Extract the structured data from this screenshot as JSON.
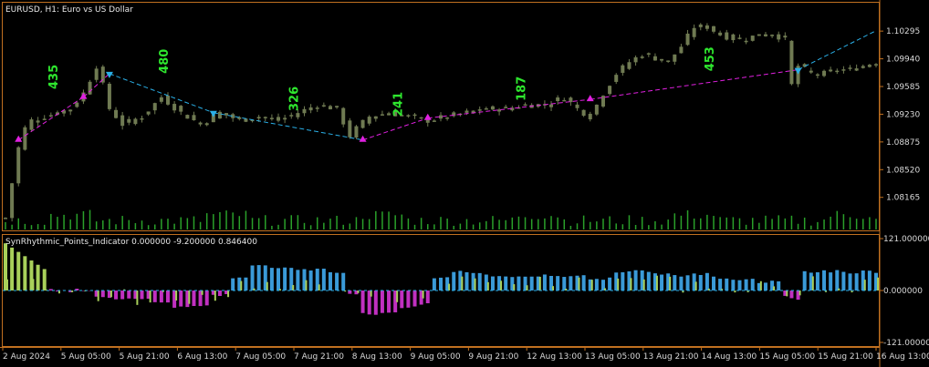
{
  "window": {
    "symbol_title": "EURUSD, H1:  Euro vs US Dollar",
    "indicator_title": "SynRhythmic_Points_Indicator 0.000000 -9.200000 0.846400"
  },
  "colors": {
    "background": "#000000",
    "frame": "#c07020",
    "candle": "#6f7a52",
    "volume": "#2aa02a",
    "up_line": "#2ab0e8",
    "down_line": "#e020e0",
    "count_label": "#2ee62e",
    "hist_blue": "#3a9ad8",
    "hist_magenta": "#c030c0",
    "hist_green": "#a8d05a"
  },
  "price_axis": [
    "1.10295",
    "1.09940",
    "1.09585",
    "1.09230",
    "1.08875",
    "1.08520",
    "1.08165"
  ],
  "indicator_axis": [
    "121.000000",
    "0.000000",
    "-121.000000"
  ],
  "time_axis": [
    "2 Aug 2024",
    "5 Aug 05:00",
    "5 Aug 21:00",
    "6 Aug 13:00",
    "7 Aug 05:00",
    "7 Aug 21:00",
    "8 Aug 13:00",
    "9 Aug 05:00",
    "9 Aug 21:00",
    "12 Aug 13:00",
    "13 Aug 05:00",
    "13 Aug 21:00",
    "14 Aug 13:00",
    "15 Aug 05:00",
    "15 Aug 21:00",
    "16 Aug 13:00"
  ],
  "chart_data": {
    "type": "line",
    "y_range": [
      1.078,
      1.106
    ],
    "price_path": [
      [
        0,
        1.079
      ],
      [
        2,
        1.088
      ],
      [
        3,
        1.0905
      ],
      [
        4,
        1.0915
      ],
      [
        6,
        1.092
      ],
      [
        8,
        1.0925
      ],
      [
        10,
        1.093
      ],
      [
        12,
        1.095
      ],
      [
        14,
        1.0985
      ],
      [
        15,
        1.096
      ],
      [
        16,
        1.093
      ],
      [
        18,
        1.091
      ],
      [
        21,
        1.092
      ],
      [
        24,
        1.0945
      ],
      [
        27,
        1.0925
      ],
      [
        30,
        1.091
      ],
      [
        33,
        1.0925
      ],
      [
        36,
        1.0915
      ],
      [
        39,
        1.092
      ],
      [
        42,
        1.0915
      ],
      [
        45,
        1.0925
      ],
      [
        48,
        1.0935
      ],
      [
        51,
        1.093
      ],
      [
        53,
        1.0895
      ],
      [
        54,
        1.0905
      ],
      [
        56,
        1.092
      ],
      [
        59,
        1.0925
      ],
      [
        62,
        1.092
      ],
      [
        65,
        1.0915
      ],
      [
        68,
        1.092
      ],
      [
        71,
        1.0925
      ],
      [
        74,
        1.093
      ],
      [
        77,
        1.093
      ],
      [
        80,
        1.0935
      ],
      [
        83,
        1.0935
      ],
      [
        86,
        1.0945
      ],
      [
        88,
        1.093
      ],
      [
        90,
        1.092
      ],
      [
        92,
        1.095
      ],
      [
        94,
        1.0975
      ],
      [
        96,
        1.099
      ],
      [
        98,
        1.1
      ],
      [
        100,
        1.0995
      ],
      [
        102,
        1.099
      ],
      [
        104,
        1.101
      ],
      [
        106,
        1.1035
      ],
      [
        108,
        1.1035
      ],
      [
        110,
        1.1025
      ],
      [
        112,
        1.102
      ],
      [
        114,
        1.102
      ],
      [
        116,
        1.1025
      ],
      [
        118,
        1.1025
      ],
      [
        120,
        1.102
      ],
      [
        121,
        1.096
      ],
      [
        122,
        1.0985
      ],
      [
        124,
        1.0975
      ],
      [
        126,
        1.0975
      ],
      [
        128,
        1.098
      ],
      [
        130,
        1.098
      ],
      [
        132,
        1.0985
      ],
      [
        134,
        1.099
      ]
    ],
    "swing_points": [
      {
        "x": 2,
        "y": 1.089,
        "dir": "down"
      },
      {
        "x": 12,
        "y": 1.0945,
        "dir": "down"
      },
      {
        "x": 16,
        "y": 1.0975,
        "dir": "up"
      },
      {
        "x": 32,
        "y": 1.0925,
        "dir": "up"
      },
      {
        "x": 55,
        "y": 1.089,
        "dir": "down"
      },
      {
        "x": 65,
        "y": 1.0918,
        "dir": "down"
      },
      {
        "x": 90,
        "y": 1.0942,
        "dir": "down"
      },
      {
        "x": 122,
        "y": 1.098,
        "dir": "up"
      }
    ],
    "swing_counts": [
      {
        "label": "435",
        "x": 8,
        "y": 1.0955
      },
      {
        "label": "480",
        "x": 25,
        "y": 1.0975
      },
      {
        "label": "326",
        "x": 45,
        "y": 1.0927
      },
      {
        "label": "241",
        "x": 61,
        "y": 1.092
      },
      {
        "label": "187",
        "x": 80,
        "y": 1.094
      },
      {
        "label": "453",
        "x": 109,
        "y": 1.0978
      }
    ],
    "indicator": {
      "y_range": [
        -121,
        121
      ],
      "histogram_blue": [
        [
          35,
          30
        ],
        [
          38,
          60
        ],
        [
          41,
          55
        ],
        [
          44,
          50
        ],
        [
          47,
          48
        ],
        [
          50,
          40
        ],
        [
          53,
          0
        ],
        [
          66,
          30
        ],
        [
          69,
          45
        ],
        [
          72,
          40
        ],
        [
          75,
          35
        ],
        [
          78,
          30
        ],
        [
          81,
          35
        ],
        [
          84,
          32
        ],
        [
          87,
          35
        ],
        [
          90,
          28
        ],
        [
          94,
          42
        ],
        [
          97,
          45
        ],
        [
          100,
          40
        ],
        [
          103,
          35
        ],
        [
          106,
          38
        ],
        [
          109,
          30
        ],
        [
          112,
          25
        ],
        [
          116,
          20
        ],
        [
          120,
          0
        ],
        [
          123,
          42
        ],
        [
          126,
          45
        ],
        [
          129,
          42
        ],
        [
          132,
          45
        ],
        [
          134,
          42
        ]
      ],
      "histogram_magenta": [
        [
          14,
          -15
        ],
        [
          17,
          -20
        ],
        [
          20,
          -22
        ],
        [
          23,
          -25
        ],
        [
          26,
          -40
        ],
        [
          29,
          -35
        ],
        [
          32,
          -10
        ],
        [
          55,
          -55
        ],
        [
          58,
          -50
        ],
        [
          61,
          -40
        ],
        [
          64,
          -30
        ],
        [
          91,
          -55
        ],
        [
          94,
          -45
        ],
        [
          97,
          -40
        ],
        [
          100,
          -38
        ],
        [
          103,
          -35
        ],
        [
          106,
          -30
        ],
        [
          109,
          -25
        ],
        [
          112,
          -20
        ],
        [
          115,
          -15
        ],
        [
          121,
          -20
        ]
      ]
    }
  }
}
